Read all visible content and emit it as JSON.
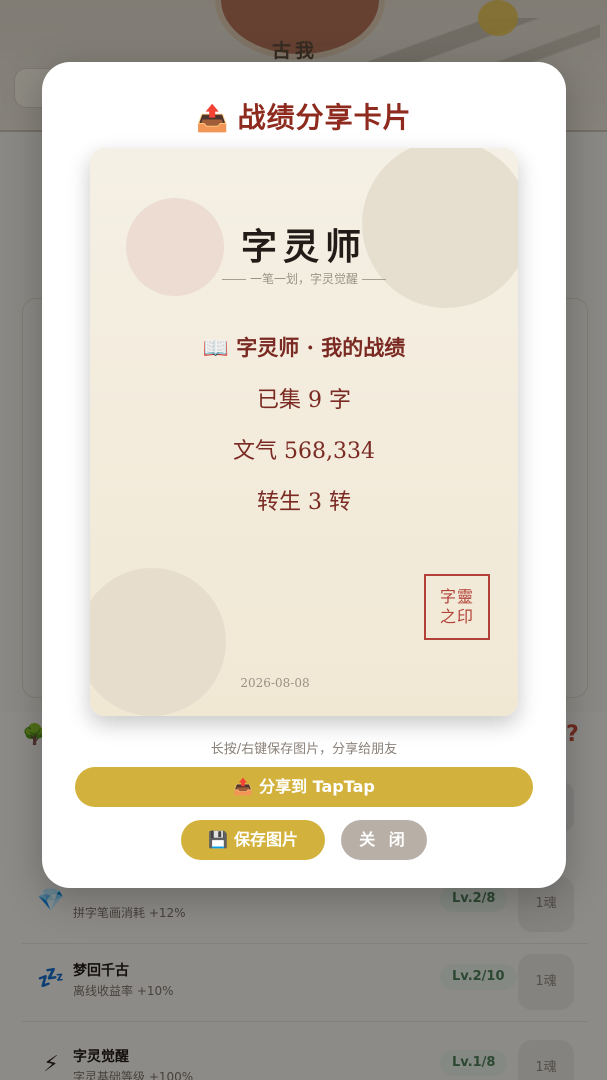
{
  "app": {
    "header_title": "古我",
    "colors": {
      "accent": "#d2b23c",
      "title_red": "#8e2b1e",
      "seal_red": "#b24238",
      "level_green": "#4f7d57"
    }
  },
  "upgrades": [
    {
      "icon": "gem-icon",
      "glyph": "💎",
      "name": "",
      "desc": "拼字笔画消耗 +12%",
      "level": "Lv.2/8",
      "cost": "1魂"
    },
    {
      "icon": "sleep-icon",
      "glyph": "💤",
      "name": "梦回千古",
      "desc": "离线收益率 +10%",
      "level": "Lv.2/10",
      "cost": "1魂"
    },
    {
      "icon": "lightning-icon",
      "glyph": "⚡",
      "name": "字灵觉醒",
      "desc": "字灵基础等级 +100%",
      "level": "Lv.1/8",
      "cost": "1魂"
    }
  ],
  "modal": {
    "title_icon": "outbox-tray-icon",
    "title": "战绩分享卡片",
    "card": {
      "title": "字灵师",
      "subtitle": "一笔一划，字灵觉醒",
      "stats_heading": "📖 字灵师 · 我的战绩",
      "stat_collected": "已集 9 字",
      "stat_wenqi": "文气 568,334",
      "stat_rebirth": "转生 3 转",
      "seal_line1": "字靈",
      "seal_line2": "之印",
      "date": "2026-08-08"
    },
    "hint": "长按/右键保存图片，分享给朋友",
    "share_button": "分享到 TapTap",
    "save_button": "保存图片",
    "close_button": "关 闭"
  }
}
